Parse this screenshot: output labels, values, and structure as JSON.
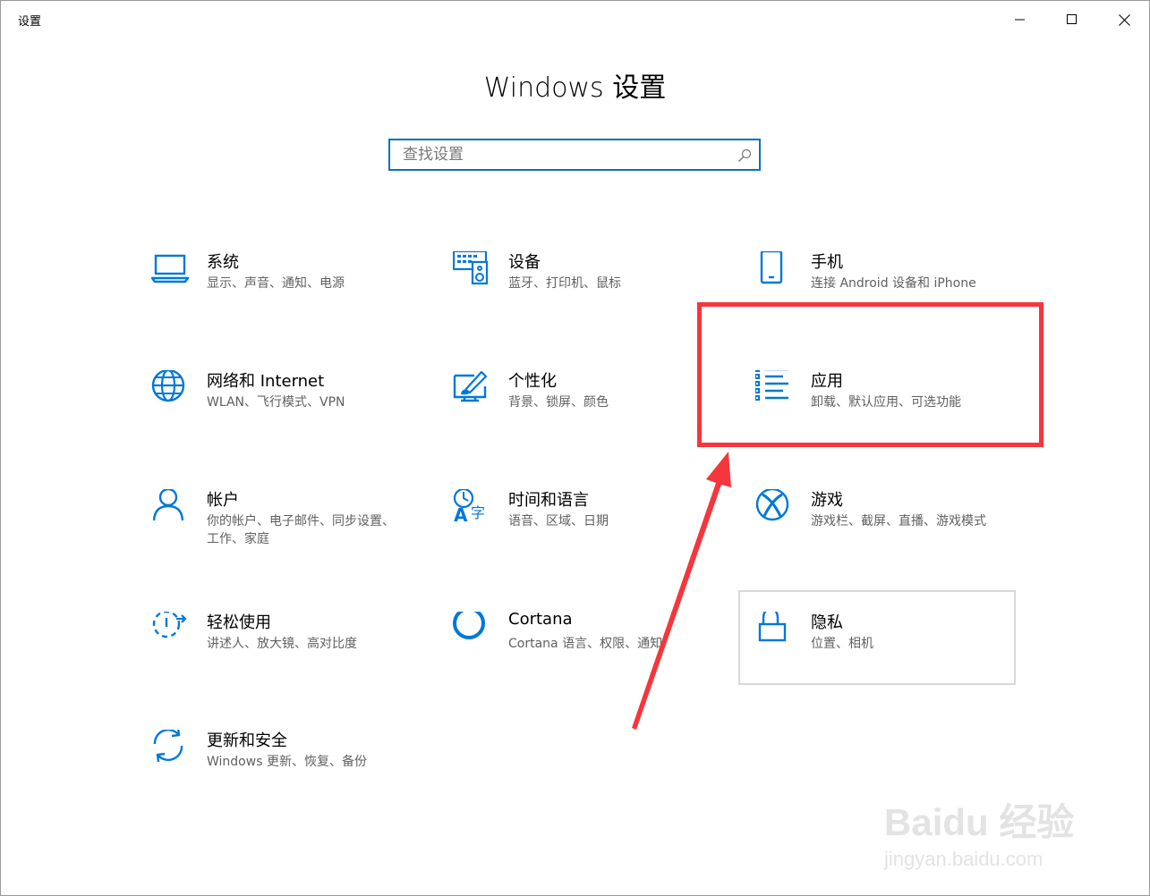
{
  "window": {
    "title": "设置",
    "controls": {
      "minimize": "minimize",
      "maximize": "maximize",
      "close": "close"
    }
  },
  "page": {
    "title": "Windows 设置"
  },
  "search": {
    "placeholder": "查找设置",
    "value": ""
  },
  "tiles": [
    {
      "icon": "laptop-icon",
      "title": "系统",
      "desc": "显示、声音、通知、电源"
    },
    {
      "icon": "keyboard-speaker-icon",
      "title": "设备",
      "desc": "蓝牙、打印机、鼠标"
    },
    {
      "icon": "phone-icon",
      "title": "手机",
      "desc": "连接 Android 设备和 iPhone"
    },
    {
      "icon": "globe-icon",
      "title": "网络和 Internet",
      "desc": "WLAN、飞行模式、VPN"
    },
    {
      "icon": "paint-brush-icon",
      "title": "个性化",
      "desc": "背景、锁屏、颜色"
    },
    {
      "icon": "app-list-icon",
      "title": "应用",
      "desc": "卸载、默认应用、可选功能"
    },
    {
      "icon": "person-icon",
      "title": "帐户",
      "desc": "你的帐户、电子邮件、同步设置、工作、家庭"
    },
    {
      "icon": "time-language-icon",
      "title": "时间和语言",
      "desc": "语音、区域、日期"
    },
    {
      "icon": "xbox-icon",
      "title": "游戏",
      "desc": "游戏栏、截屏、直播、游戏模式"
    },
    {
      "icon": "ease-of-access-icon",
      "title": "轻松使用",
      "desc": "讲述人、放大镜、高对比度"
    },
    {
      "icon": "cortana-icon",
      "title": "Cortana",
      "desc": "Cortana 语言、权限、通知"
    },
    {
      "icon": "lock-icon",
      "title": "隐私",
      "desc": "位置、相机"
    },
    {
      "icon": "sync-icon",
      "title": "更新和安全",
      "desc": "Windows 更新、恢复、备份"
    }
  ],
  "colors": {
    "accent": "#0078d7",
    "annotation": "#f5363c"
  },
  "watermark": {
    "main": "Baidu 经验",
    "sub": "jingyan.baidu.com"
  }
}
